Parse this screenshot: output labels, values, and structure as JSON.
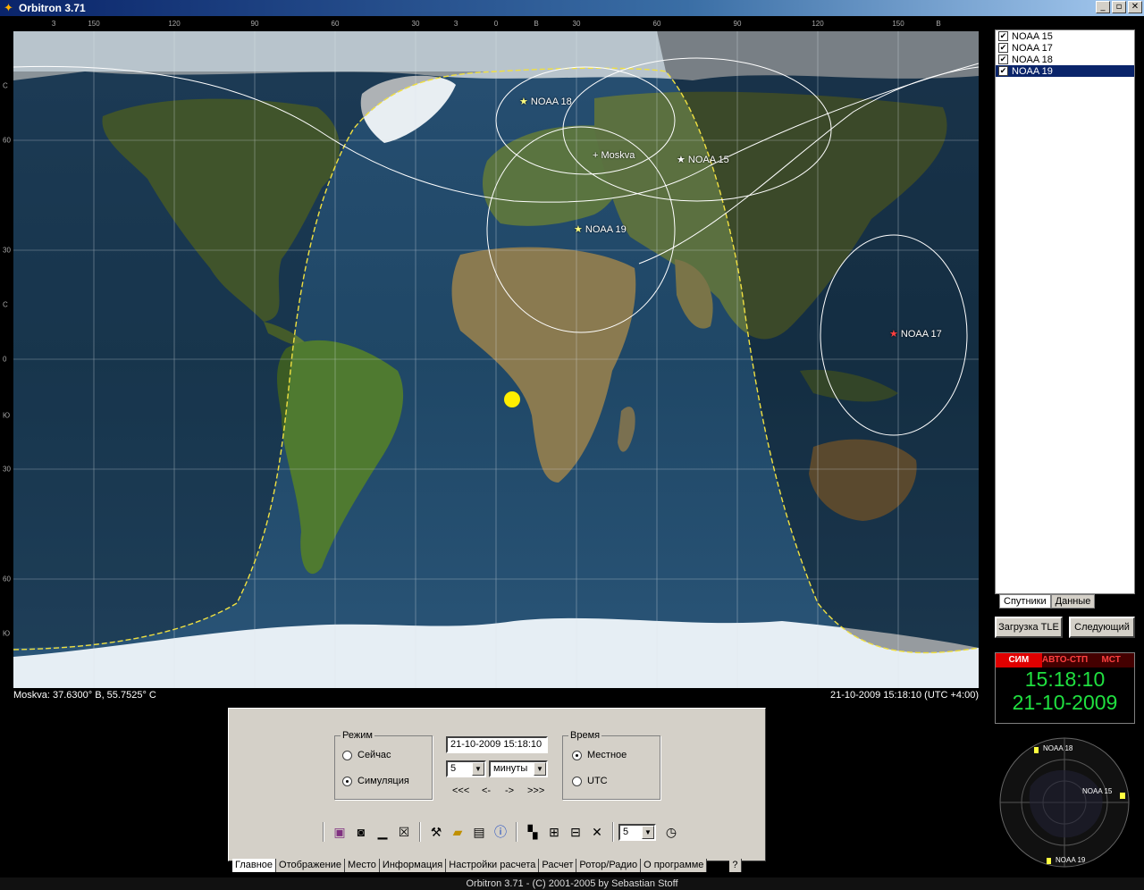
{
  "window": {
    "title": "Orbitron 3.71",
    "controls": [
      "_",
      "▫",
      "✕"
    ]
  },
  "map": {
    "lon_labels": [
      "З",
      "150",
      "120",
      "90",
      "60",
      "30",
      "З",
      "0",
      "В",
      "30",
      "60",
      "90",
      "120",
      "150",
      "В"
    ],
    "lat_labels": [
      "С",
      "60",
      "30",
      "С",
      "0",
      "Ю",
      "30",
      "60",
      "Ю"
    ],
    "city": "Moskva",
    "satellites": [
      {
        "name": "NOAA 18",
        "color": "#ffff80"
      },
      {
        "name": "NOAA 15",
        "color": "#ffffff"
      },
      {
        "name": "NOAA 19",
        "color": "#ffff80"
      },
      {
        "name": "NOAA 17",
        "color": "#ff4040"
      }
    ]
  },
  "status": {
    "location": "Moskva: 37.6300° В, 55.7525° С",
    "datetime": "21-10-2009 15:18:10 (UTC +4:00)"
  },
  "satlist": {
    "items": [
      {
        "name": "NOAA 15",
        "checked": "✔"
      },
      {
        "name": "NOAA 17",
        "checked": "✔"
      },
      {
        "name": "NOAA 18",
        "checked": "✔"
      },
      {
        "name": "NOAA 19",
        "checked": "✔"
      }
    ],
    "tabs": [
      "Спутники",
      "Данные"
    ]
  },
  "buttons": {
    "load_tle": "Загрузка TLE",
    "next": "Следующий"
  },
  "clock": {
    "modes": [
      "СИМ",
      "АВТО-СТП",
      "МСТ"
    ],
    "time": "15:18:10",
    "date": "21-10-2009"
  },
  "radar": {
    "labels": [
      "NOAA 18",
      "NOAA 15",
      "NOAA 19"
    ]
  },
  "control": {
    "mode_group": "Режим",
    "mode_now": "Сейчас",
    "mode_sim": "Симуляция",
    "datetime_value": "21-10-2009 15:18:10",
    "step_value": "5",
    "step_unit": "минуты",
    "nav": [
      "<<<",
      "<-",
      "->",
      ">>>"
    ],
    "time_group": "Время",
    "time_local": "Местное",
    "time_utc": "UTC",
    "toolbar_value": "5"
  },
  "tabs": [
    "Главное",
    "Отображение",
    "Место",
    "Информация",
    "Настройки расчета",
    "Расчет",
    "Ротор/Радио",
    "О программе",
    "?"
  ],
  "footer": "Orbitron 3.71 - (C) 2001-2005 by Sebastian Stoff"
}
